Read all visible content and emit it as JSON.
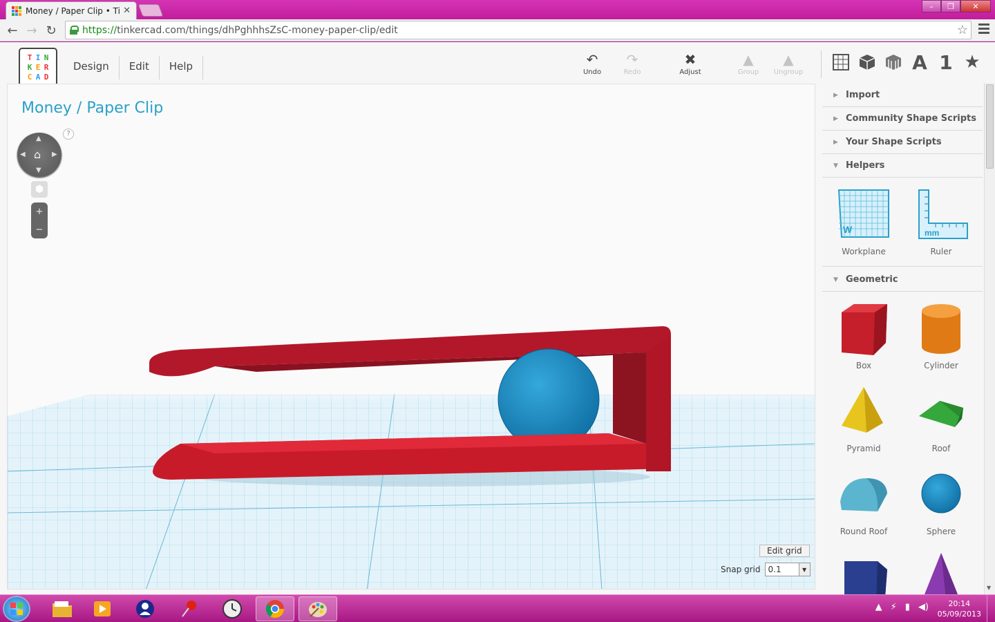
{
  "browser": {
    "tab_title": "Money / Paper Clip • Tink",
    "url_https": "https://",
    "url_rest": "tinkercad.com/things/dhPghhhsZsC-money-paper-clip/edit"
  },
  "app": {
    "logo_letters": [
      "T",
      "I",
      "N",
      "K",
      "E",
      "R",
      "C",
      "A",
      "D"
    ],
    "menu": [
      "Design",
      "Edit",
      "Help"
    ],
    "tools": {
      "undo": "Undo",
      "redo": "Redo",
      "adjust": "Adjust",
      "group": "Group",
      "ungroup": "Ungroup"
    },
    "view_icons": [
      "grid-icon",
      "cube-icon",
      "wireframe-icon",
      "text-icon",
      "number-icon",
      "star-icon"
    ],
    "view_text": {
      "a": "A",
      "one": "1",
      "star": "★"
    }
  },
  "viewport": {
    "design_title": "Money / Paper Clip",
    "help": "?",
    "edit_grid": "Edit grid",
    "snap_grid_label": "Snap grid",
    "snap_grid_value": "0.1"
  },
  "panel": {
    "sections": {
      "import": "Import",
      "community": "Community Shape Scripts",
      "your_scripts": "Your Shape Scripts",
      "helpers": "Helpers",
      "geometric": "Geometric"
    },
    "helpers": [
      "Workplane",
      "Ruler"
    ],
    "geometric": [
      "Box",
      "Cylinder",
      "Pyramid",
      "Roof",
      "Round Roof",
      "Sphere"
    ]
  },
  "taskbar": {
    "time": "20:14",
    "date": "05/09/2013"
  },
  "colors": {
    "accent": "#2aa0c8",
    "clip_red": "#c81b2a",
    "sphere_blue": "#1a8bc4",
    "taskbar": "#b8208f"
  }
}
